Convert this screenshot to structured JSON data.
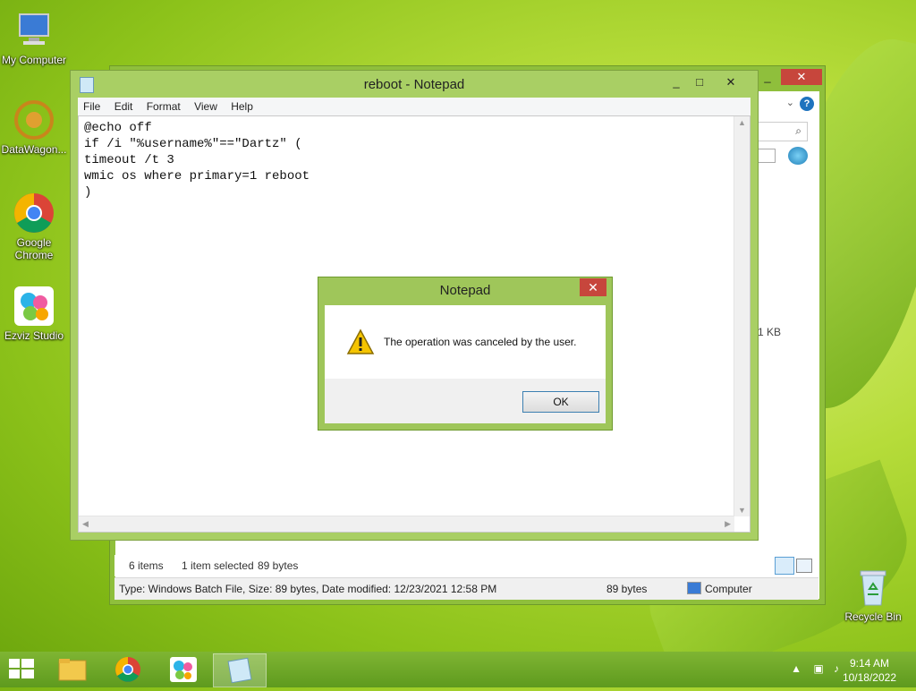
{
  "desktop": {
    "icons": [
      {
        "label": "My Computer"
      },
      {
        "label": "DataWagon..."
      },
      {
        "label": "Google Chrome"
      },
      {
        "label": "Ezviz Studio"
      },
      {
        "label": "Recycle Bin"
      }
    ]
  },
  "explorer": {
    "size_column": "1 KB",
    "status": {
      "items": "6 items",
      "selected": "1 item selected",
      "selected_size": "89 bytes",
      "detail": "Type: Windows Batch File, Size: 89 bytes, Date modified: 12/23/2021 12:58 PM",
      "size": "89 bytes",
      "location": "Computer"
    }
  },
  "notepad": {
    "title": "reboot - Notepad",
    "menu": [
      "File",
      "Edit",
      "Format",
      "View",
      "Help"
    ],
    "content": "@echo off\nif /i \"%username%\"==\"Dartz\" (\ntimeout /t 3\nwmic os where primary=1 reboot\n)"
  },
  "dialog": {
    "title": "Notepad",
    "message": "The operation was canceled by the user.",
    "ok_label": "OK"
  },
  "taskbar": {
    "time": "9:14 AM",
    "date": "10/18/2022"
  }
}
